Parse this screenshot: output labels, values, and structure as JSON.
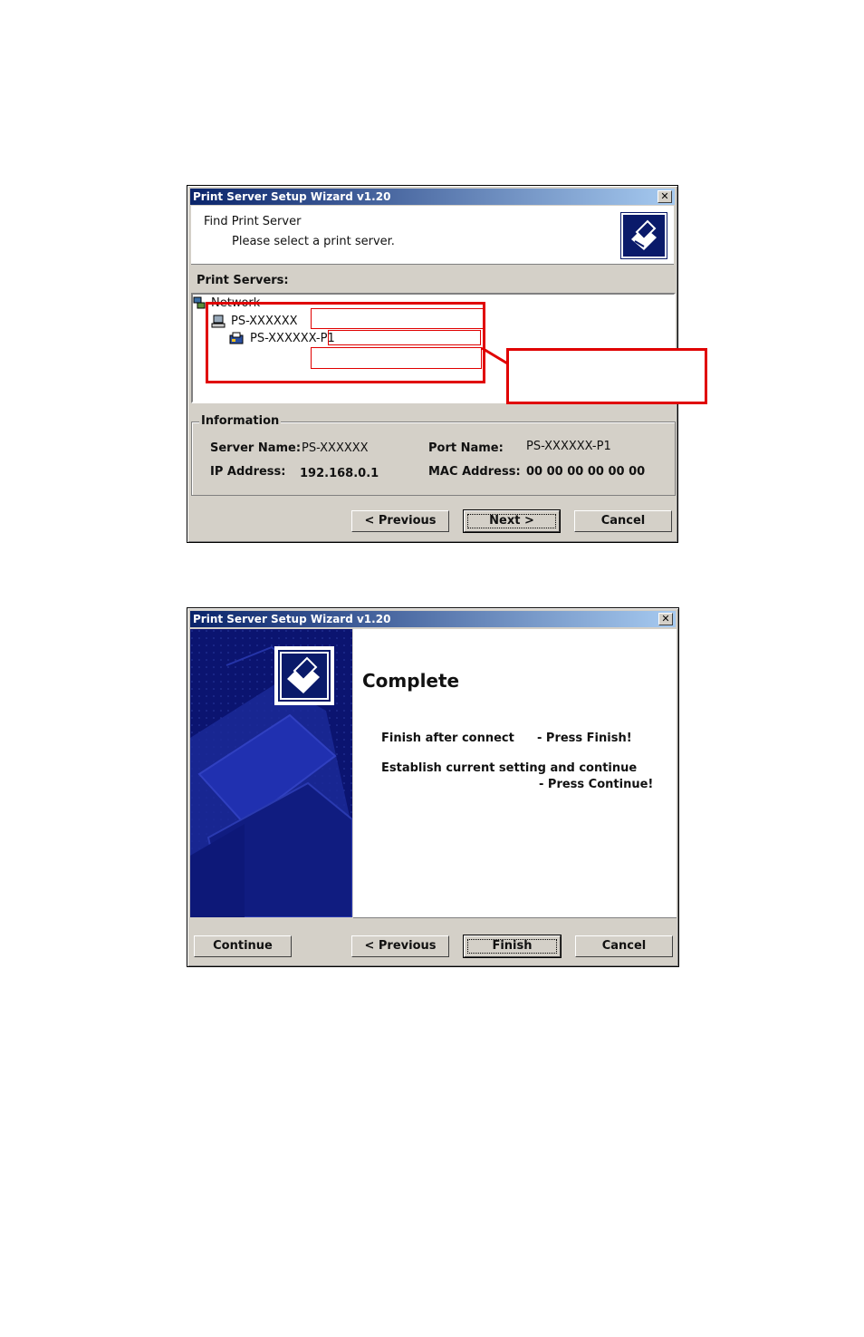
{
  "dialog1": {
    "title": "Print Server Setup Wizard v1.20",
    "close_glyph": "✕",
    "header_title": "Find Print Server",
    "header_subtitle": "Please select a print server.",
    "list_label": "Print Servers:",
    "tree": {
      "root_label": "Network",
      "server_label": "PS-XXXXXX",
      "port_label": "PS-XXXXXX-P1"
    },
    "info": {
      "legend": "Information",
      "server_name_label": "Server Name:",
      "server_name_value": "PS-XXXXXX",
      "port_name_label": "Port Name:",
      "port_name_value": "PS-XXXXXX-P1",
      "ip_label": "IP Address:",
      "ip_value": "192.168.0.1",
      "mac_label": "MAC Address:",
      "mac_value": "00 00 00 00 00 00"
    },
    "buttons": {
      "previous": "< Previous",
      "next": "Next >",
      "cancel": "Cancel"
    }
  },
  "dialog2": {
    "title": "Print Server Setup Wizard v1.20",
    "close_glyph": "✕",
    "heading": "Complete",
    "line1_left": "Finish after connect",
    "line1_right": "- Press Finish!",
    "line2": "Establish current setting and continue",
    "line3": "- Press Continue!",
    "buttons": {
      "continue": "Continue",
      "previous": "< Previous",
      "finish": "Finish",
      "cancel": "Cancel"
    }
  },
  "colors": {
    "title_gradient_start": "#0a246a",
    "annotation_red": "#e00000",
    "sidebar_blue": "#0b1470"
  }
}
